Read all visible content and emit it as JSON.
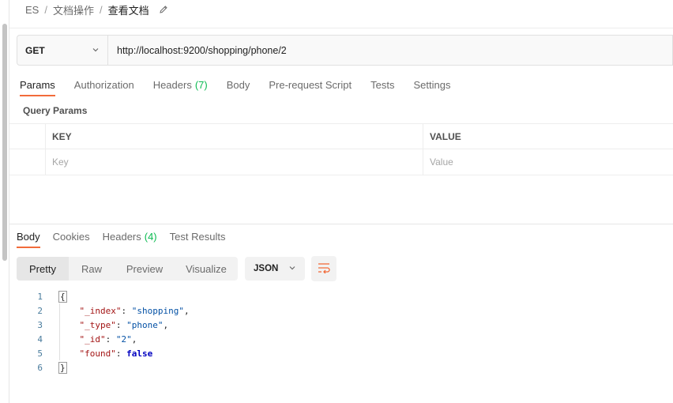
{
  "breadcrumb": {
    "items": [
      "ES",
      "文档操作"
    ],
    "current": "查看文档",
    "separator": "/"
  },
  "request": {
    "method": "GET",
    "url": "http://localhost:9200/shopping/phone/2"
  },
  "request_tabs": [
    {
      "label": "Params",
      "count": ""
    },
    {
      "label": "Authorization",
      "count": ""
    },
    {
      "label": "Headers",
      "count": "(7)"
    },
    {
      "label": "Body",
      "count": ""
    },
    {
      "label": "Pre-request Script",
      "count": ""
    },
    {
      "label": "Tests",
      "count": ""
    },
    {
      "label": "Settings",
      "count": ""
    }
  ],
  "query_params": {
    "title": "Query Params",
    "key_header": "KEY",
    "value_header": "VALUE",
    "key_placeholder": "Key",
    "value_placeholder": "Value"
  },
  "response_tabs": [
    {
      "label": "Body",
      "count": ""
    },
    {
      "label": "Cookies",
      "count": ""
    },
    {
      "label": "Headers",
      "count": "(4)"
    },
    {
      "label": "Test Results",
      "count": ""
    }
  ],
  "view_modes": [
    "Pretty",
    "Raw",
    "Preview",
    "Visualize"
  ],
  "format_select": "JSON",
  "response_body": {
    "line_numbers": [
      "1",
      "2",
      "3",
      "4",
      "5",
      "6"
    ],
    "open_brace": "{",
    "close_brace": "}",
    "fields": [
      {
        "key": "\"_index\"",
        "value": "\"shopping\"",
        "suffix": ","
      },
      {
        "key": "\"_type\"",
        "value": "\"phone\"",
        "suffix": ","
      },
      {
        "key": "\"_id\"",
        "value": "\"2\"",
        "suffix": ","
      },
      {
        "key": "\"found\"",
        "value": "false",
        "suffix": ""
      }
    ]
  },
  "colors": {
    "accent": "#f26b3a",
    "count_green": "#0cbb52"
  }
}
